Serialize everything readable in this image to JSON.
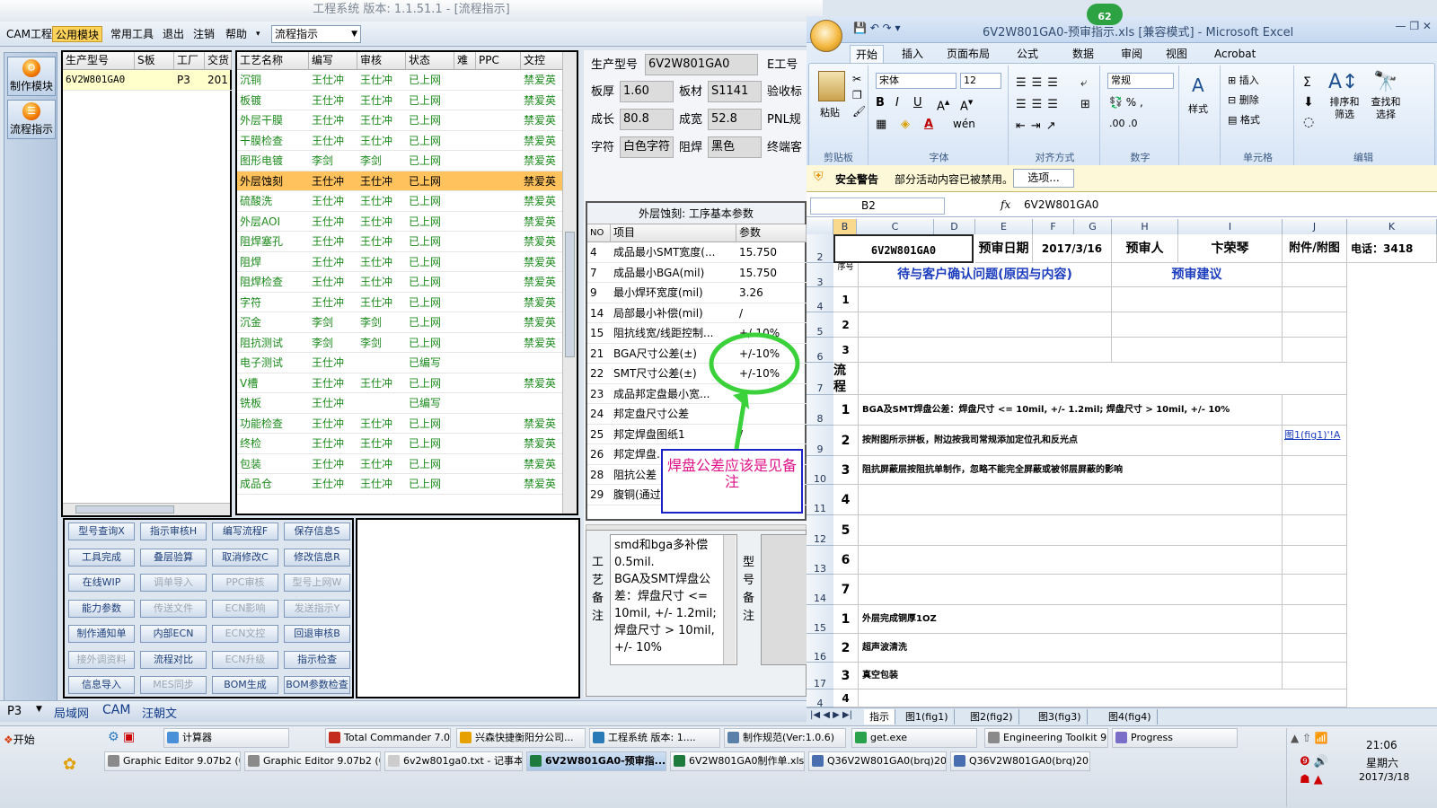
{
  "app": {
    "title": "工程系统  版本: 1.1.51.1 - [流程指示]"
  },
  "menu": {
    "items": [
      "CAM工程",
      "公用模块",
      "常用工具",
      "退出",
      "注销",
      "帮助"
    ],
    "flow_select": "流程指示"
  },
  "leftnav": {
    "items": [
      "制作模块",
      "流程指示"
    ]
  },
  "jobs": {
    "columns": [
      "生产型号",
      "S板",
      "工厂",
      "交货"
    ],
    "rows": [
      {
        "model": "6V2W801GA0",
        "s": "",
        "factory": "P3",
        "date": "201"
      }
    ]
  },
  "process": {
    "columns": [
      "工艺名称",
      "编写",
      "审核",
      "状态",
      "难",
      "PPC",
      "文控"
    ],
    "rows": [
      [
        "沉铜",
        "王仕冲",
        "王仕冲",
        "已上网",
        "",
        "",
        "禁爱英"
      ],
      [
        "板镀",
        "王仕冲",
        "王仕冲",
        "已上网",
        "",
        "",
        "禁爱英"
      ],
      [
        "外层干膜",
        "王仕冲",
        "王仕冲",
        "已上网",
        "",
        "",
        "禁爱英"
      ],
      [
        "干膜检查",
        "王仕冲",
        "王仕冲",
        "已上网",
        "",
        "",
        "禁爱英"
      ],
      [
        "图形电镀",
        "李剑",
        "李剑",
        "已上网",
        "",
        "",
        "禁爱英"
      ],
      [
        "外层蚀刻",
        "王仕冲",
        "王仕冲",
        "已上网",
        "",
        "",
        "禁爱英"
      ],
      [
        "硫酸洗",
        "王仕冲",
        "王仕冲",
        "已上网",
        "",
        "",
        "禁爱英"
      ],
      [
        "外层AOI",
        "王仕冲",
        "王仕冲",
        "已上网",
        "",
        "",
        "禁爱英"
      ],
      [
        "阻焊塞孔",
        "王仕冲",
        "王仕冲",
        "已上网",
        "",
        "",
        "禁爱英"
      ],
      [
        "阻焊",
        "王仕冲",
        "王仕冲",
        "已上网",
        "",
        "",
        "禁爱英"
      ],
      [
        "阻焊检查",
        "王仕冲",
        "王仕冲",
        "已上网",
        "",
        "",
        "禁爱英"
      ],
      [
        "字符",
        "王仕冲",
        "王仕冲",
        "已上网",
        "",
        "",
        "禁爱英"
      ],
      [
        "沉金",
        "李剑",
        "李剑",
        "已上网",
        "",
        "",
        "禁爱英"
      ],
      [
        "阻抗测试",
        "李剑",
        "李剑",
        "已上网",
        "",
        "",
        "禁爱英"
      ],
      [
        "电子测试",
        "王仕冲",
        "",
        "已编写",
        "",
        "",
        ""
      ],
      [
        "V槽",
        "王仕冲",
        "王仕冲",
        "已上网",
        "",
        "",
        "禁爱英"
      ],
      [
        "铣板",
        "王仕冲",
        "",
        "已编写",
        "",
        "",
        ""
      ],
      [
        "功能检查",
        "王仕冲",
        "王仕冲",
        "已上网",
        "",
        "",
        "禁爱英"
      ],
      [
        "终检",
        "王仕冲",
        "王仕冲",
        "已上网",
        "",
        "",
        "禁爱英"
      ],
      [
        "包装",
        "王仕冲",
        "王仕冲",
        "已上网",
        "",
        "",
        "禁爱英"
      ],
      [
        "成品仓",
        "王仕冲",
        "王仕冲",
        "已上网",
        "",
        "",
        "禁爱英"
      ]
    ],
    "highlight_index": 5
  },
  "actions": {
    "buttons": [
      [
        "型号查询X",
        "指示审核H",
        "编写流程F",
        "保存信息S"
      ],
      [
        "工具完成",
        "叠层验算",
        "取消修改C",
        "修改信息R"
      ],
      [
        "在线WIP",
        "调单导入",
        "PPC审核",
        "型号上网W"
      ],
      [
        "能力参数",
        "传送文件",
        "ECN影响",
        "发送指示Y"
      ],
      [
        "制作通知单",
        "内部ECN",
        "ECN文控",
        "回退审核B"
      ],
      [
        "接外调资料",
        "流程对比",
        "ECN升级",
        "指示检查"
      ],
      [
        "信息导入",
        "MES同步",
        "BOM生成",
        "BOM参数检查"
      ]
    ],
    "disabled": [
      "调单导入",
      "PPC审核",
      "型号上网W",
      "传送文件",
      "ECN影响",
      "发送指示Y",
      "ECN文控",
      "接外调资料",
      "ECN升级",
      "MES同步"
    ]
  },
  "info": {
    "prod_model_label": "生产型号",
    "prod_model": "6V2W801GA0",
    "e_label": "E工号",
    "thick_label": "板厚",
    "thick": "1.60",
    "material_label": "板材",
    "material": "S1141",
    "check_label": "验收标",
    "len_label": "成长",
    "len": "80.8",
    "wid_label": "成宽",
    "wid": "52.8",
    "pnl_label": "PNL规",
    "char_label": "字符",
    "char": "白色字符",
    "mask_label": "阻焊",
    "mask": "黑色",
    "end_label": "终端客"
  },
  "params": {
    "title": "外层蚀刻: 工序基本参数",
    "columns": [
      "NO",
      "项目",
      "参数"
    ],
    "rows": [
      [
        "4",
        "成品最小SMT宽度(...",
        "15.750"
      ],
      [
        "7",
        "成品最小BGA(mil)",
        "15.750"
      ],
      [
        "9",
        "最小焊环宽度(mil)",
        "3.26"
      ],
      [
        "14",
        "局部最小补偿(mil)",
        "/"
      ],
      [
        "15",
        "阻抗线宽/线距控制...",
        "+/-10%"
      ],
      [
        "21",
        "BGA尺寸公差(±)",
        "+/-10%"
      ],
      [
        "22",
        "SMT尺寸公差(±)",
        "+/-10%"
      ],
      [
        "23",
        "成品邦定盘最小宽...",
        "/"
      ],
      [
        "24",
        "邦定盘尺寸公差",
        "/"
      ],
      [
        "25",
        "邦定焊盘图纸1",
        "/"
      ],
      [
        "26",
        "邦定焊盘...",
        ""
      ],
      [
        "28",
        "阻抗公差",
        ""
      ],
      [
        "29",
        "腹铜(通过...",
        ""
      ]
    ]
  },
  "annotation": {
    "text": "焊盘公差应该是见备注"
  },
  "remarks": {
    "proc_label": "工艺备注",
    "proc_text": "smd和bga多补偿0.5mil.\nBGA及SMT焊盘公差：焊盘尺寸 <= 10mil, +/- 1.2mil; 焊盘尺寸 > 10mil, +/- 10%",
    "model_label": "型号备注"
  },
  "statusbar": {
    "items": [
      "P3",
      "局域网",
      "CAM",
      "汪朝文"
    ]
  },
  "excel": {
    "title": "6V2W801GA0-预审指示.xls [兼容模式] - Microsoft Excel",
    "badge": "62",
    "tabs": [
      "开始",
      "插入",
      "页面布局",
      "公式",
      "数据",
      "审阅",
      "视图",
      "Acrobat"
    ],
    "font_name": "宋体",
    "font_size": "12",
    "number_format": "常规",
    "groups": [
      "剪贴板",
      "字体",
      "对齐方式",
      "数字",
      "样式",
      "单元格",
      "编辑"
    ],
    "ribbon_labels": {
      "paste": "粘贴",
      "style": "样式",
      "insert": "插入",
      "delete": "删除",
      "format": "格式",
      "sort": "排序和筛选",
      "find": "查找和选择"
    },
    "security": {
      "title": "安全警告",
      "msg": "部分活动内容已被禁用。",
      "options": "选项..."
    },
    "name_box": "B2",
    "formula": "6V2W801GA0",
    "columns": [
      "B",
      "C",
      "D",
      "E",
      "F",
      "G",
      "H",
      "I",
      "J",
      "K"
    ],
    "row_nums": [
      "2",
      "3",
      "4",
      "5",
      "6",
      "7",
      "8",
      "9",
      "10",
      "11",
      "12",
      "13",
      "14",
      "15",
      "16",
      "17",
      "4"
    ],
    "header_row": {
      "model": "6V2W801GA0",
      "date_label": "预审日期",
      "date": "2017/3/16",
      "person_label": "预审人",
      "person": "卞荣琴",
      "attach": "附件/附图",
      "phone": "电话：3418"
    },
    "row3": {
      "seq": "序号",
      "issue": "待与客户确认问题(原因与内容)",
      "advice": "预审建议"
    },
    "flow_label": "流程",
    "notes": [
      "BGA及SMT焊盘公差：焊盘尺寸 <= 10mil, +/- 1.2mil; 焊盘尺寸 > 10mil, +/- 10%",
      "按附图所示拼板，附边按我司常规添加定位孔和反光点",
      "阻抗屏蔽层按阻抗单制作，忽略不能完全屏蔽或被邻层屏蔽的影响"
    ],
    "link": "图1(fig1)'!A",
    "extra": [
      "外层完成铜厚1OZ",
      "超声波清洗",
      "真空包装"
    ],
    "sheet_tabs": [
      "指示",
      "图1(fig1)",
      "图2(fig2)",
      "图3(fig3)",
      "图4(fig4)"
    ]
  },
  "taskbar": {
    "start": "开始",
    "row1": [
      "计算器",
      "Total Commander 7.0 ...",
      "兴森快捷衡阳分公司...",
      "工程系统  版本: 1....",
      "制作规范(Ver:1.0.6)",
      "get.exe",
      "Engineering Toolkit 9....",
      "Progress"
    ],
    "row2": [
      "Graphic Editor 9.07b2 (0...",
      "Graphic Editor 9.07b2 (0...",
      "6v2w801ga0.txt - 记事本",
      "6V2W801GA0-预审指...",
      "6V2W801GA0制作单.xls...",
      "Q36V2W801GA0(brq)20...",
      "Q36V2W801GA0(brq)20..."
    ],
    "time": "21:06",
    "day": "星期六",
    "date": "2017/3/18"
  }
}
